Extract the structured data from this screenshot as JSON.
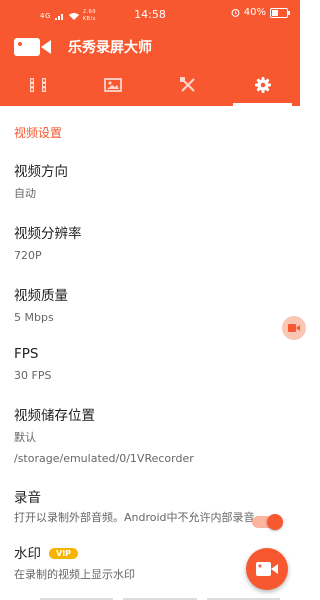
{
  "status_bar": {
    "network": "4G",
    "speed": "2.60",
    "speed_unit": "KB/s",
    "time": "14:58",
    "battery_percent": "40%",
    "battery_level": 0.4
  },
  "app": {
    "title": "乐秀录屏大师"
  },
  "tabs": [
    {
      "icon": "film-icon",
      "active": false
    },
    {
      "icon": "image-icon",
      "active": false
    },
    {
      "icon": "tools-icon",
      "active": false
    },
    {
      "icon": "gear-icon",
      "active": true
    }
  ],
  "section_title": "视频设置",
  "settings": {
    "orientation": {
      "label": "视频方向",
      "value": "自动"
    },
    "resolution": {
      "label": "视频分辨率",
      "value": "720P"
    },
    "quality": {
      "label": "视频质量",
      "value": "5 Mbps"
    },
    "fps": {
      "label": "FPS",
      "value": "30 FPS"
    },
    "storage": {
      "label": "视频储存位置",
      "value": "默认",
      "path": "/storage/emulated/0/1VRecorder"
    },
    "audio": {
      "label": "录音",
      "desc": "打开以录制外部音频。Android中不允许内部录音",
      "enabled": true
    },
    "watermark": {
      "label": "水印",
      "badge": "VIP",
      "desc": "在录制的视频上显示水印"
    }
  },
  "colors": {
    "accent": "#f7582f",
    "vip": "#f6b400"
  }
}
